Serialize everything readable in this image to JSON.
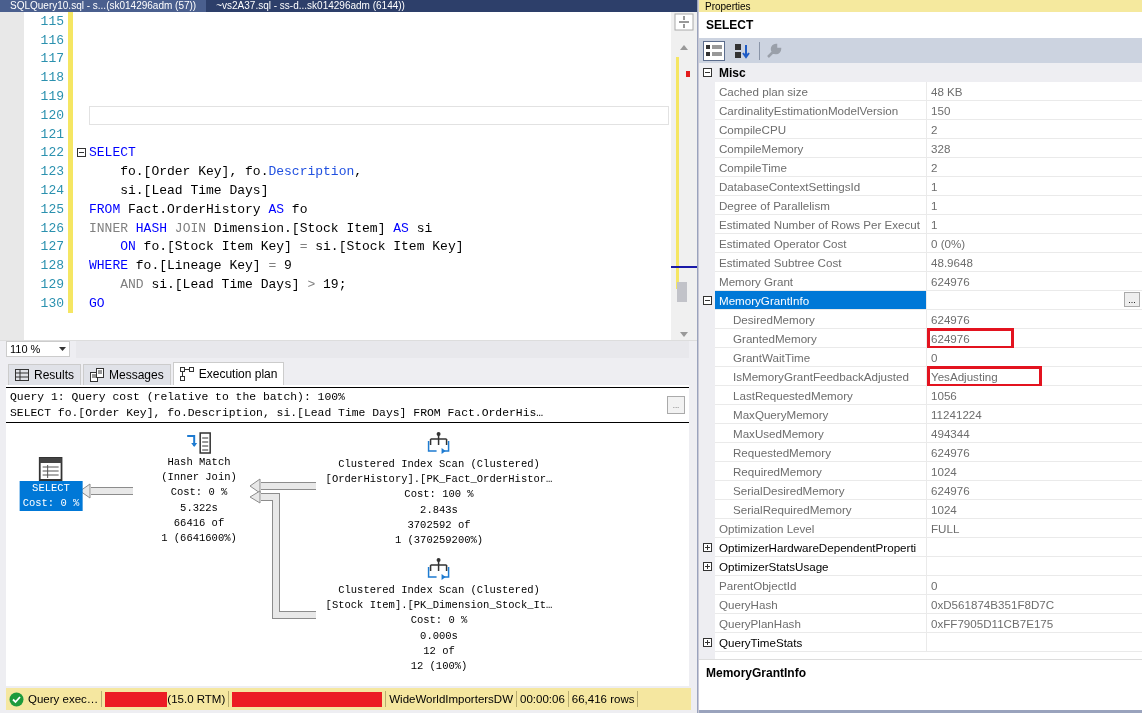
{
  "document_tabs": [
    {
      "label": "SQLQuery10.sql - s...(sk014296adm (57))",
      "selected": true
    },
    {
      "label": "~vs2A37.sql - ss-d...sk014296adm (6144))",
      "selected": false
    }
  ],
  "editor": {
    "lines": [
      {
        "number": "115"
      },
      {
        "number": "116"
      },
      {
        "number": "117"
      },
      {
        "number": "118"
      },
      {
        "number": "119"
      },
      {
        "number": "120",
        "current": true
      },
      {
        "number": "121"
      },
      {
        "number": "122",
        "foldable": true,
        "tokens": [
          {
            "kind": "kw",
            "text": "SELECT"
          }
        ]
      },
      {
        "number": "123",
        "tokens": [
          {
            "kind": "plain",
            "text": "    fo.[Order Key], fo."
          },
          {
            "kind": "fn",
            "text": "Description"
          },
          {
            "kind": "plain",
            "text": ","
          }
        ]
      },
      {
        "number": "124",
        "tokens": [
          {
            "kind": "plain",
            "text": "    si.[Lead Time Days]"
          }
        ]
      },
      {
        "number": "125",
        "tokens": [
          {
            "kind": "kw",
            "text": "FROM"
          },
          {
            "kind": "plain",
            "text": " Fact.OrderHistory "
          },
          {
            "kind": "kw",
            "text": "AS"
          },
          {
            "kind": "plain",
            "text": " fo"
          }
        ]
      },
      {
        "number": "126",
        "tokens": [
          {
            "kind": "op",
            "text": "INNER"
          },
          {
            "kind": "kw",
            "text": " HASH"
          },
          {
            "kind": "op",
            "text": " JOIN"
          },
          {
            "kind": "plain",
            "text": " Dimension.[Stock Item] "
          },
          {
            "kind": "kw",
            "text": "AS"
          },
          {
            "kind": "plain",
            "text": " si"
          }
        ]
      },
      {
        "number": "127",
        "tokens": [
          {
            "kind": "kw",
            "text": "    ON"
          },
          {
            "kind": "plain",
            "text": " fo.[Stock Item Key] "
          },
          {
            "kind": "op",
            "text": "="
          },
          {
            "kind": "plain",
            "text": " si.[Stock Item Key]"
          }
        ]
      },
      {
        "number": "128",
        "tokens": [
          {
            "kind": "kw",
            "text": "WHERE"
          },
          {
            "kind": "plain",
            "text": " fo.[Lineage Key] "
          },
          {
            "kind": "op",
            "text": "="
          },
          {
            "kind": "plain",
            "text": " 9"
          }
        ]
      },
      {
        "number": "129",
        "tokens": [
          {
            "kind": "op",
            "text": "    AND"
          },
          {
            "kind": "plain",
            "text": " si.[Lead Time Days] "
          },
          {
            "kind": "op",
            "text": ">"
          },
          {
            "kind": "plain",
            "text": " 19;"
          }
        ]
      },
      {
        "number": "130",
        "tokens": [
          {
            "kind": "kw",
            "text": "GO"
          }
        ]
      }
    ],
    "zoom": "110 %"
  },
  "result_tabs": [
    {
      "label": "Results",
      "selected": false
    },
    {
      "label": "Messages",
      "selected": false
    },
    {
      "label": "Execution plan",
      "selected": true
    }
  ],
  "plan": {
    "header": [
      "Query 1: Query cost (relative to the batch): 100%",
      "SELECT fo.[Order Key], fo.Description, si.[Lead Time Days] FROM Fact.OrderHis…"
    ],
    "more_button": "...",
    "nodes": [
      {
        "kind": "select",
        "selected": true,
        "lines": [
          "SELECT",
          "Cost: 0 %"
        ]
      },
      {
        "kind": "hash",
        "selected": false,
        "lines": [
          "Hash Match",
          "(Inner Join)",
          "Cost: 0 %",
          "5.322s",
          "66416 of",
          "1 (6641600%)"
        ]
      },
      {
        "kind": "scan",
        "selected": false,
        "lines": [
          "Clustered Index Scan (Clustered)",
          "[OrderHistory].[PK_Fact_OrderHistor…",
          "Cost: 100 %",
          "2.843s",
          "3702592 of",
          "1 (370259200%)"
        ]
      },
      {
        "kind": "scan",
        "selected": false,
        "lines": [
          "Clustered Index Scan (Clustered)",
          "[Stock Item].[PK_Dimension_Stock_It…",
          "Cost: 0 %",
          "0.000s",
          "12 of",
          "12 (100%)"
        ]
      }
    ]
  },
  "status_bar": [
    {
      "kind": "success",
      "text": "Query exec…"
    },
    {
      "kind": "redacted",
      "text": "(15.0 RTM)"
    },
    {
      "kind": "redacted"
    },
    {
      "kind": "text",
      "text": "WideWorldImportersDW"
    },
    {
      "kind": "text",
      "text": "00:00:06"
    },
    {
      "kind": "text",
      "text": "66,416 rows"
    }
  ],
  "properties": {
    "title": "Properties",
    "object": "SELECT",
    "rows": [
      {
        "kind": "category",
        "name": "Misc",
        "expanded": true,
        "children": [
          {
            "kind": "property",
            "name": "Cached plan size",
            "value": "48 KB"
          },
          {
            "kind": "property",
            "name": "CardinalityEstimationModelVersion",
            "value": "150"
          },
          {
            "kind": "property",
            "name": "CompileCPU",
            "value": "2"
          },
          {
            "kind": "property",
            "name": "CompileMemory",
            "value": "328"
          },
          {
            "kind": "property",
            "name": "CompileTime",
            "value": "2"
          },
          {
            "kind": "property",
            "name": "DatabaseContextSettingsId",
            "value": "1"
          },
          {
            "kind": "property",
            "name": "Degree of Parallelism",
            "value": "1"
          },
          {
            "kind": "property",
            "name": "Estimated Number of Rows Per Execut",
            "value": "1"
          },
          {
            "kind": "property",
            "name": "Estimated Operator Cost",
            "value": "0 (0%)"
          },
          {
            "kind": "property",
            "name": "Estimated Subtree Cost",
            "value": "48.9648"
          },
          {
            "kind": "property",
            "name": "Memory Grant",
            "value": "624976"
          },
          {
            "kind": "group",
            "name": "MemoryGrantInfo",
            "expanded": true,
            "selected": true,
            "button": "...",
            "children": [
              {
                "kind": "property",
                "name": "DesiredMemory",
                "value": "624976"
              },
              {
                "kind": "property",
                "name": "GrantedMemory",
                "value": "624976",
                "highlighted": true
              },
              {
                "kind": "property",
                "name": "GrantWaitTime",
                "value": "0"
              },
              {
                "kind": "property",
                "name": "IsMemoryGrantFeedbackAdjusted",
                "value": "YesAdjusting",
                "highlighted": true
              },
              {
                "kind": "property",
                "name": "LastRequestedMemory",
                "value": "1056"
              },
              {
                "kind": "property",
                "name": "MaxQueryMemory",
                "value": "11241224"
              },
              {
                "kind": "property",
                "name": "MaxUsedMemory",
                "value": "494344"
              },
              {
                "kind": "property",
                "name": "RequestedMemory",
                "value": "624976"
              },
              {
                "kind": "property",
                "name": "RequiredMemory",
                "value": "1024"
              },
              {
                "kind": "property",
                "name": "SerialDesiredMemory",
                "value": "624976"
              },
              {
                "kind": "property",
                "name": "SerialRequiredMemory",
                "value": "1024"
              }
            ]
          },
          {
            "kind": "property",
            "name": "Optimization Level",
            "value": "FULL"
          },
          {
            "kind": "group",
            "name": "OptimizerHardwareDependentProperti",
            "expanded": false,
            "selected": false
          },
          {
            "kind": "group",
            "name": "OptimizerStatsUsage",
            "expanded": false,
            "selected": false
          },
          {
            "kind": "property",
            "name": "ParentObjectId",
            "value": "0"
          },
          {
            "kind": "property",
            "name": "QueryHash",
            "value": "0xD561874B351F8D7C"
          },
          {
            "kind": "property",
            "name": "QueryPlanHash",
            "value": "0xFF7905D11CB7E175"
          },
          {
            "kind": "group",
            "name": "QueryTimeStats",
            "expanded": false,
            "selected": false
          }
        ]
      }
    ],
    "description": "MemoryGrantInfo"
  }
}
